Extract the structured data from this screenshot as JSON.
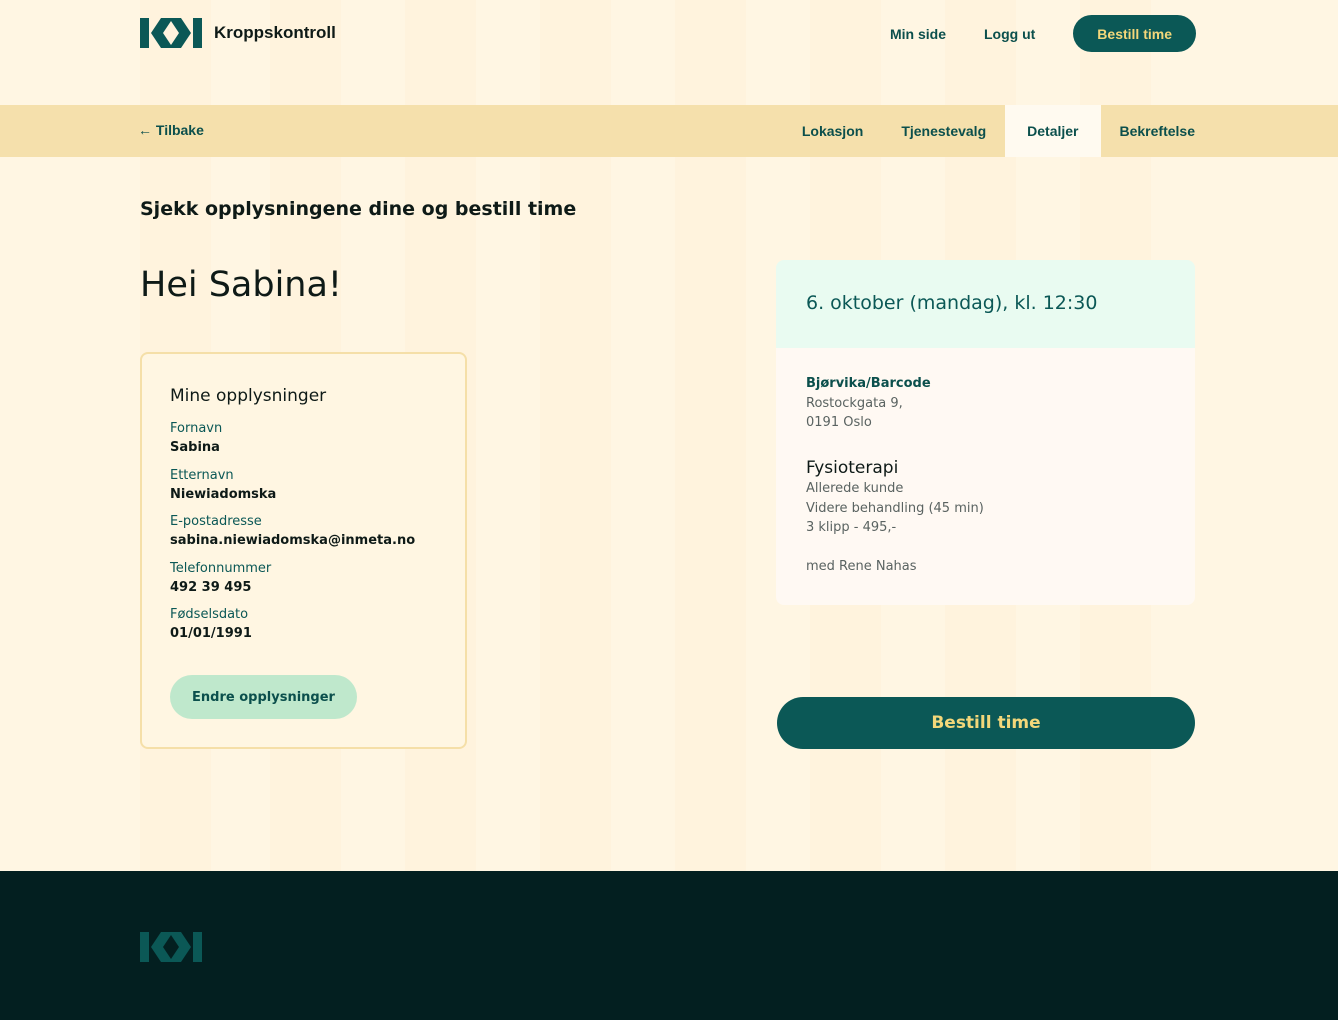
{
  "header": {
    "brand": "Kroppskontroll",
    "nav": [
      "Min side",
      "Logg ut"
    ],
    "cta": "Bestill time"
  },
  "stepbar": {
    "back": "← Tilbake",
    "steps": [
      "Lokasjon",
      "Tjenestevalg",
      "Detaljer",
      "Bekreftelse"
    ],
    "active_step": "Detaljer"
  },
  "main": {
    "subtitle": "Sjekk opplysningene dine og bestill time",
    "greeting": "Hei Sabina!"
  },
  "profile": {
    "title": "Mine opplysninger",
    "fields": [
      {
        "label": "Fornavn",
        "value": "Sabina"
      },
      {
        "label": "Etternavn",
        "value": "Niewiadomska"
      },
      {
        "label": "E-postadresse",
        "value": "sabina.niewiadomska@inmeta.no"
      },
      {
        "label": "Telefonnummer",
        "value": "492 39 495"
      },
      {
        "label": "Fødselsdato",
        "value": "01/01/1991"
      }
    ],
    "edit_button": "Endre opplysninger"
  },
  "booking": {
    "datetime": "6. oktober (mandag), kl. 12:30",
    "location_name": "Bjørvika/Barcode",
    "address_line1": "Rostockgata 9,",
    "address_line2": "0191 Oslo",
    "service": "Fysioterapi",
    "customer_type": "Allerede kunde",
    "treatment": "Videre behandling (45 min)",
    "price": "3 klipp - 495,-",
    "therapist": "med Rene Nahas",
    "book_button": "Bestill time"
  },
  "colors": {
    "primary": "#0b5856",
    "accent": "#f3d77a",
    "stepbar": "#f5e0ac",
    "footer": "#031f20",
    "soft_green": "#bfe8cc"
  },
  "icons": {
    "brand": "kroppskontroll-logo"
  }
}
